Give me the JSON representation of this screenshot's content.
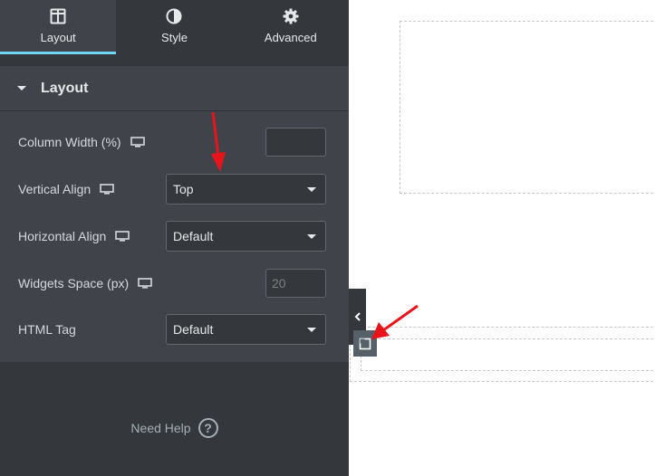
{
  "tabs": [
    {
      "label": "Layout",
      "icon": "columns-icon",
      "active": true
    },
    {
      "label": "Style",
      "icon": "half-circle-icon",
      "active": false
    },
    {
      "label": "Advanced",
      "icon": "gear-icon",
      "active": false
    }
  ],
  "section": {
    "title": "Layout",
    "expanded": true
  },
  "controls": {
    "column_width": {
      "label": "Column Width (%)",
      "value": ""
    },
    "vertical_align": {
      "label": "Vertical Align",
      "value": "Top"
    },
    "horizontal_align": {
      "label": "Horizontal Align",
      "value": "Default"
    },
    "widgets_space": {
      "label": "Widgets Space (px)",
      "placeholder": "20"
    },
    "html_tag": {
      "label": "HTML Tag",
      "value": "Default"
    }
  },
  "help": {
    "label": "Need Help",
    "icon": "question-icon"
  },
  "colors": {
    "panel_bg": "#34383c",
    "section_bg": "#404349",
    "accent": "#71d7f7",
    "annotation_arrow": "#e8141b"
  }
}
